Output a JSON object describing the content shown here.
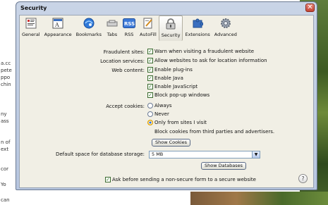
{
  "background": {
    "left_text": [
      "a.cc",
      "pete",
      "ppo",
      "chin",
      "ny",
      "ass",
      "n of",
      "ext",
      "cor",
      "Yo",
      "can"
    ]
  },
  "window": {
    "title": "Security",
    "close_glyph": "✕"
  },
  "toolbar": {
    "items": [
      {
        "label": "General",
        "icon": "general-icon"
      },
      {
        "label": "Appearance",
        "icon": "appearance-icon"
      },
      {
        "label": "Bookmarks",
        "icon": "bookmarks-icon"
      },
      {
        "label": "Tabs",
        "icon": "tabs-icon"
      },
      {
        "label": "RSS",
        "icon": "rss-icon"
      },
      {
        "label": "AutoFill",
        "icon": "autofill-icon"
      },
      {
        "label": "Security",
        "icon": "lock-icon",
        "active": true
      },
      {
        "label": "Extensions",
        "icon": "extensions-icon"
      },
      {
        "label": "Advanced",
        "icon": "gear-icon"
      }
    ]
  },
  "security": {
    "fraudulent_label": "Fraudulent sites:",
    "fraudulent_option": "Warn when visiting a fraudulent website",
    "location_label": "Location services:",
    "location_option": "Allow websites to ask for location information",
    "web_content_label": "Web content:",
    "web_content_options": [
      "Enable plug-ins",
      "Enable Java",
      "Enable JavaScript",
      "Block pop-up windows"
    ],
    "cookies_label": "Accept cookies:",
    "cookies_options": [
      "Always",
      "Never",
      "Only from sites I visit"
    ],
    "cookies_selected": "Only from sites I visit",
    "cookies_note": "Block cookies from third parties and advertisers.",
    "show_cookies_button": "Show Cookies",
    "db_storage_label": "Default space for database storage:",
    "db_storage_value": "5 MB",
    "show_databases_button": "Show Databases",
    "nonsecure_form_option": "Ask before sending a non-secure form to a secure website",
    "help_glyph": "?"
  }
}
